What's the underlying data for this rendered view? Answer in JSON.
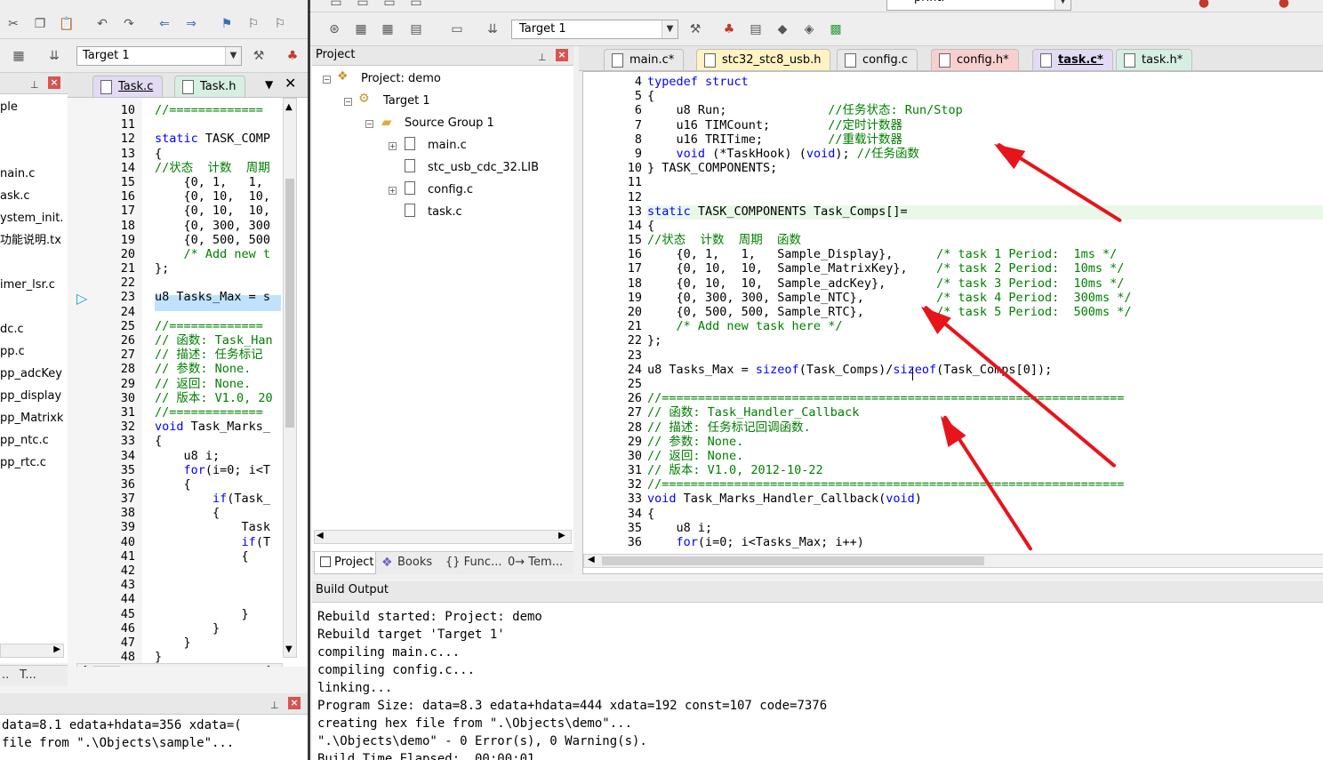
{
  "bg_window": {
    "toolbar_target": "Target 1",
    "left_items": [
      "ple",
      "nain.c",
      "ask.c",
      "ystem_init.",
      "功能说明.tx",
      "imer_lsr.c",
      "dc.c",
      "pp.c",
      "pp_adcKey",
      "pp_display",
      "pp_Matrixk",
      "pp_ntc.c",
      "pp_rtc.c"
    ],
    "tabs": [
      "Task.c",
      "Task.h"
    ],
    "code_lines": [
      {
        "n": "10",
        "t": "//============="
      },
      {
        "n": "11",
        "t": ""
      },
      {
        "n": "12",
        "t": "static TASK_COMP"
      },
      {
        "n": "13",
        "t": "{"
      },
      {
        "n": "14",
        "t": "//状态  计数  周期"
      },
      {
        "n": "15",
        "t": "    {0, 1,   1,"
      },
      {
        "n": "16",
        "t": "    {0, 10,  10,"
      },
      {
        "n": "17",
        "t": "    {0, 10,  10,"
      },
      {
        "n": "18",
        "t": "    {0, 300, 300"
      },
      {
        "n": "19",
        "t": "    {0, 500, 500"
      },
      {
        "n": "20",
        "t": "    /* Add new t"
      },
      {
        "n": "21",
        "t": "};"
      },
      {
        "n": "22",
        "t": ""
      },
      {
        "n": "23",
        "t": "u8 Tasks_Max = s"
      },
      {
        "n": "24",
        "t": ""
      },
      {
        "n": "25",
        "t": "//============="
      },
      {
        "n": "26",
        "t": "// 函数: Task_Han"
      },
      {
        "n": "27",
        "t": "// 描述: 任务标记"
      },
      {
        "n": "28",
        "t": "// 参数: None."
      },
      {
        "n": "29",
        "t": "// 返回: None."
      },
      {
        "n": "30",
        "t": "// 版本: V1.0, 20"
      },
      {
        "n": "31",
        "t": "//============="
      },
      {
        "n": "32",
        "t": "void Task_Marks_"
      },
      {
        "n": "33",
        "t": "{"
      },
      {
        "n": "34",
        "t": "    u8 i;"
      },
      {
        "n": "35",
        "t": "    for(i=0; i<T"
      },
      {
        "n": "36",
        "t": "    {"
      },
      {
        "n": "37",
        "t": "        if(Task_"
      },
      {
        "n": "38",
        "t": "        {"
      },
      {
        "n": "39",
        "t": "            Task"
      },
      {
        "n": "40",
        "t": "            if(T"
      },
      {
        "n": "41",
        "t": "            {"
      },
      {
        "n": "42",
        "t": ""
      },
      {
        "n": "43",
        "t": ""
      },
      {
        "n": "44",
        "t": ""
      },
      {
        "n": "45",
        "t": "            }"
      },
      {
        "n": "46",
        "t": "        }"
      },
      {
        "n": "47",
        "t": "    }"
      },
      {
        "n": "48",
        "t": "}"
      }
    ],
    "bottom_tabs": [
      "..",
      "T..."
    ],
    "output_lines": [
      "data=8.1 edata+hdata=356 xdata=(",
      "file from \".\\Objects\\sample\"..."
    ]
  },
  "fg_window": {
    "toolbar_target": "Target 1",
    "toolbar_top_text": "printf",
    "project_panel": {
      "title": "Project",
      "tree": [
        {
          "label": "Project: demo",
          "indent": 0
        },
        {
          "label": "Target 1",
          "indent": 1
        },
        {
          "label": "Source Group 1",
          "indent": 2
        },
        {
          "label": "main.c",
          "indent": 3
        },
        {
          "label": "stc_usb_cdc_32.LIB",
          "indent": 3
        },
        {
          "label": "config.c",
          "indent": 3
        },
        {
          "label": "task.c",
          "indent": 3
        }
      ],
      "bottom_tabs": [
        "Project",
        "Books",
        "{} Func...",
        "0→ Tem..."
      ]
    },
    "editor_tabs": [
      {
        "label": "main.c*",
        "color": "#e9e9e9"
      },
      {
        "label": "stc32_stc8_usb.h",
        "color": "#fff3c4"
      },
      {
        "label": "config.c",
        "color": "#e9e9e9"
      },
      {
        "label": "config.h*",
        "color": "#f8cfcf"
      },
      {
        "label": "task.c*",
        "color": "#e2dbf3"
      },
      {
        "label": "task.h*",
        "color": "#d7efe3"
      }
    ],
    "build_output": {
      "title": "Build Output",
      "lines": [
        "Rebuild started: Project: demo",
        "Rebuild target 'Target 1'",
        "compiling main.c...",
        "compiling config.c...",
        "linking...",
        "Program Size: data=8.3 edata+hdata=444 xdata=192 const=107 code=7376",
        "creating hex file from \".\\Objects\\demo\"...",
        "\".\\Objects\\demo\" - 0 Error(s), 0 Warning(s).",
        "Build Time Elapsed:  00:00:01"
      ]
    }
  },
  "code": [
    {
      "n": "4",
      "parts": [
        [
          "kw",
          "typedef struct"
        ]
      ]
    },
    {
      "n": "5",
      "parts": [
        [
          "",
          "{"
        ]
      ]
    },
    {
      "n": "6",
      "parts": [
        [
          "",
          "    u8 Run;              "
        ],
        [
          "cm",
          "//任务状态: Run/Stop"
        ]
      ]
    },
    {
      "n": "7",
      "parts": [
        [
          "",
          "    u16 TIMCount;        "
        ],
        [
          "cm",
          "//定时计数器"
        ]
      ]
    },
    {
      "n": "8",
      "parts": [
        [
          "",
          "    u16 TRITime;         "
        ],
        [
          "cm",
          "//重载计数器"
        ]
      ]
    },
    {
      "n": "9",
      "parts": [
        [
          "",
          "    "
        ],
        [
          "kw",
          "void"
        ],
        [
          "",
          " (*TaskHook) ("
        ],
        [
          "kw",
          "void"
        ],
        [
          "",
          "); "
        ],
        [
          "cm",
          "//任务函数"
        ]
      ]
    },
    {
      "n": "10",
      "parts": [
        [
          "",
          "} TASK_COMPONENTS;"
        ]
      ]
    },
    {
      "n": "11",
      "parts": [
        [
          "",
          ""
        ]
      ]
    },
    {
      "n": "12",
      "parts": [
        [
          "",
          ""
        ]
      ]
    },
    {
      "n": "13",
      "parts": [
        [
          "kw",
          "static"
        ],
        [
          "",
          " TASK_COMPONENTS Task_Comps[]="
        ]
      ]
    },
    {
      "n": "14",
      "parts": [
        [
          "",
          "{"
        ]
      ]
    },
    {
      "n": "15",
      "parts": [
        [
          "cm",
          "//状态  计数  周期  函数"
        ]
      ]
    },
    {
      "n": "16",
      "parts": [
        [
          "",
          "    {0, 1,   1,   Sample_Display},      "
        ],
        [
          "cm",
          "/* task 1 Period:  1ms */"
        ]
      ]
    },
    {
      "n": "17",
      "parts": [
        [
          "",
          "    {0, 10,  10,  Sample_MatrixKey},    "
        ],
        [
          "cm",
          "/* task 2 Period:  10ms */"
        ]
      ]
    },
    {
      "n": "18",
      "parts": [
        [
          "",
          "    {0, 10,  10,  Sample_adcKey},       "
        ],
        [
          "cm",
          "/* task 3 Period:  10ms */"
        ]
      ]
    },
    {
      "n": "19",
      "parts": [
        [
          "",
          "    {0, 300, 300, Sample_NTC},          "
        ],
        [
          "cm",
          "/* task 4 Period:  300ms */"
        ]
      ]
    },
    {
      "n": "20",
      "parts": [
        [
          "",
          "    {0, 500, 500, Sample_RTC},          "
        ],
        [
          "cm",
          "/* task 5 Period:  500ms */"
        ]
      ]
    },
    {
      "n": "21",
      "parts": [
        [
          "cm",
          "    /* Add new task here */"
        ]
      ]
    },
    {
      "n": "22",
      "parts": [
        [
          "",
          "};"
        ]
      ]
    },
    {
      "n": "23",
      "parts": [
        [
          "",
          ""
        ]
      ]
    },
    {
      "n": "24",
      "parts": [
        [
          "",
          "u8 Tasks_Max = "
        ],
        [
          "kw",
          "sizeof"
        ],
        [
          "",
          "(Task_Comps)/"
        ],
        [
          "kw",
          "sizeof"
        ],
        [
          "",
          "(Task_Comps[0]);"
        ]
      ]
    },
    {
      "n": "25",
      "parts": [
        [
          "",
          ""
        ]
      ]
    },
    {
      "n": "26",
      "parts": [
        [
          "cm",
          "//================================================================"
        ]
      ]
    },
    {
      "n": "27",
      "parts": [
        [
          "cm",
          "// 函数: Task_Handler_Callback"
        ]
      ]
    },
    {
      "n": "28",
      "parts": [
        [
          "cm",
          "// 描述: 任务标记回调函数."
        ]
      ]
    },
    {
      "n": "29",
      "parts": [
        [
          "cm",
          "// 参数: None."
        ]
      ]
    },
    {
      "n": "30",
      "parts": [
        [
          "cm",
          "// 返回: None."
        ]
      ]
    },
    {
      "n": "31",
      "parts": [
        [
          "cm",
          "// 版本: V1.0, 2012-10-22"
        ]
      ]
    },
    {
      "n": "32",
      "parts": [
        [
          "cm",
          "//================================================================"
        ]
      ]
    },
    {
      "n": "33",
      "parts": [
        [
          "kw",
          "void"
        ],
        [
          "",
          " Task_Marks_Handler_Callback("
        ],
        [
          "kw",
          "void"
        ],
        [
          "",
          ")"
        ]
      ]
    },
    {
      "n": "34",
      "parts": [
        [
          "",
          "{"
        ]
      ]
    },
    {
      "n": "35",
      "parts": [
        [
          "",
          "    u8 i;"
        ]
      ]
    },
    {
      "n": "36",
      "parts": [
        [
          "",
          "    "
        ],
        [
          "kw",
          "for"
        ],
        [
          "",
          "(i=0; i<Tasks_Max; i++)"
        ]
      ]
    }
  ],
  "colors": {
    "annotation_arrow": "#e8141b",
    "keyword": "#0000ff",
    "comment": "#008000"
  }
}
